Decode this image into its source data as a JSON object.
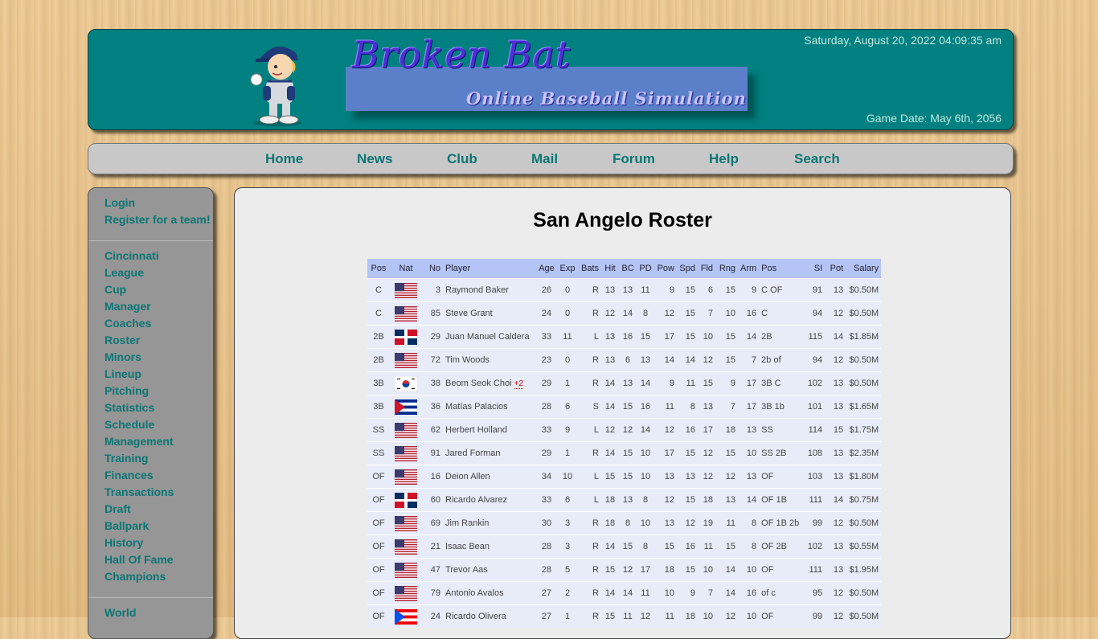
{
  "header": {
    "title": "Broken Bat",
    "subtitle": "Online Baseball Simulation",
    "datetime": "Saturday, August 20, 2022 04:09:35 am",
    "game_date": "Game Date: May 6th, 2056"
  },
  "nav": [
    "Home",
    "News",
    "Club",
    "Mail",
    "Forum",
    "Help",
    "Search"
  ],
  "sidebar": {
    "account": [
      "Login",
      "Register for a team!"
    ],
    "links": [
      "Cincinnati",
      "League",
      "Cup",
      "Manager",
      "Coaches",
      "Roster",
      "Minors",
      "Lineup",
      "Pitching",
      "Statistics",
      "Schedule",
      "Management",
      "Training",
      "Finances",
      "Transactions",
      "Draft",
      "Ballpark",
      "History",
      "Hall Of Fame",
      "Champions"
    ],
    "world": "World"
  },
  "main": {
    "title": "San Angelo Roster",
    "columns": [
      "Pos",
      "Nat",
      "No",
      "Player",
      "Age",
      "Exp",
      "Bats",
      "Hit",
      "BC",
      "PD",
      "Pow",
      "Spd",
      "Fld",
      "Rng",
      "Arm",
      "Pos",
      "SI",
      "Pot",
      "Salary"
    ],
    "players": [
      {
        "pos": "C",
        "nat": "us",
        "no": "3",
        "name": "Raymond Baker",
        "age": "26",
        "exp": "0",
        "bats": "R",
        "hit": "13",
        "bc": "13",
        "pd": "11",
        "pow": "9",
        "spd": "15",
        "fld": "6",
        "rng": "15",
        "arm": "9",
        "pos2": "C OF",
        "si": "91",
        "pot": "13",
        "salary": "$0.50M"
      },
      {
        "pos": "C",
        "nat": "us",
        "no": "85",
        "name": "Steve Grant",
        "age": "24",
        "exp": "0",
        "bats": "R",
        "hit": "12",
        "bc": "14",
        "pd": "8",
        "pow": "12",
        "spd": "15",
        "fld": "7",
        "rng": "10",
        "arm": "16",
        "pos2": "C",
        "si": "94",
        "pot": "12",
        "salary": "$0.50M"
      },
      {
        "pos": "2B",
        "nat": "do",
        "no": "29",
        "name": "Juan Manuel Caldera",
        "age": "33",
        "exp": "11",
        "bats": "L",
        "hit": "13",
        "bc": "16",
        "pd": "15",
        "pow": "17",
        "spd": "15",
        "fld": "10",
        "rng": "15",
        "arm": "14",
        "pos2": "2B",
        "si": "115",
        "pot": "14",
        "salary": "$1.85M"
      },
      {
        "pos": "2B",
        "nat": "us",
        "no": "72",
        "name": "Tim Woods",
        "age": "23",
        "exp": "0",
        "bats": "R",
        "hit": "13",
        "bc": "6",
        "pd": "13",
        "pow": "14",
        "spd": "14",
        "fld": "12",
        "rng": "15",
        "arm": "7",
        "pos2": "2b of",
        "si": "94",
        "pot": "12",
        "salary": "$0.50M"
      },
      {
        "pos": "3B",
        "nat": "kr",
        "no": "38",
        "name": "Beom Seok Choi",
        "extra": "+2",
        "age": "29",
        "exp": "1",
        "bats": "R",
        "hit": "14",
        "bc": "13",
        "pd": "14",
        "pow": "9",
        "spd": "11",
        "fld": "15",
        "rng": "9",
        "arm": "17",
        "pos2": "3B C",
        "si": "102",
        "pot": "13",
        "salary": "$0.50M"
      },
      {
        "pos": "3B",
        "nat": "cu",
        "no": "36",
        "name": "Matías Palacios",
        "age": "28",
        "exp": "6",
        "bats": "S",
        "hit": "14",
        "bc": "15",
        "pd": "16",
        "pow": "11",
        "spd": "8",
        "fld": "13",
        "rng": "7",
        "arm": "17",
        "pos2": "3B 1b",
        "si": "101",
        "pot": "13",
        "salary": "$1.65M"
      },
      {
        "pos": "SS",
        "nat": "us",
        "no": "62",
        "name": "Herbert Holland",
        "age": "33",
        "exp": "9",
        "bats": "L",
        "hit": "12",
        "bc": "12",
        "pd": "14",
        "pow": "12",
        "spd": "16",
        "fld": "17",
        "rng": "18",
        "arm": "13",
        "pos2": "SS",
        "si": "114",
        "pot": "15",
        "salary": "$1.75M"
      },
      {
        "pos": "SS",
        "nat": "us",
        "no": "91",
        "name": "Jared Forman",
        "age": "29",
        "exp": "1",
        "bats": "R",
        "hit": "14",
        "bc": "15",
        "pd": "10",
        "pow": "17",
        "spd": "15",
        "fld": "12",
        "rng": "15",
        "arm": "10",
        "pos2": "SS 2B",
        "si": "108",
        "pot": "13",
        "salary": "$2.35M"
      },
      {
        "pos": "OF",
        "nat": "us",
        "no": "16",
        "name": "Deion Allen",
        "age": "34",
        "exp": "10",
        "bats": "L",
        "hit": "15",
        "bc": "15",
        "pd": "10",
        "pow": "13",
        "spd": "13",
        "fld": "12",
        "rng": "12",
        "arm": "13",
        "pos2": "OF",
        "si": "103",
        "pot": "13",
        "salary": "$1.80M"
      },
      {
        "pos": "OF",
        "nat": "do",
        "no": "60",
        "name": "Ricardo Alvarez",
        "age": "33",
        "exp": "6",
        "bats": "L",
        "hit": "18",
        "bc": "13",
        "pd": "8",
        "pow": "12",
        "spd": "15",
        "fld": "18",
        "rng": "13",
        "arm": "14",
        "pos2": "OF 1B",
        "si": "111",
        "pot": "14",
        "salary": "$0.75M"
      },
      {
        "pos": "OF",
        "nat": "us",
        "no": "69",
        "name": "Jim Rankin",
        "age": "30",
        "exp": "3",
        "bats": "R",
        "hit": "18",
        "bc": "8",
        "pd": "10",
        "pow": "13",
        "spd": "12",
        "fld": "19",
        "rng": "11",
        "arm": "8",
        "pos2": "OF 1B 2b",
        "si": "99",
        "pot": "12",
        "salary": "$0.50M"
      },
      {
        "pos": "OF",
        "nat": "us",
        "no": "21",
        "name": "Isaac Bean",
        "age": "28",
        "exp": "3",
        "bats": "R",
        "hit": "14",
        "bc": "15",
        "pd": "8",
        "pow": "15",
        "spd": "16",
        "fld": "11",
        "rng": "15",
        "arm": "8",
        "pos2": "OF 2B",
        "si": "102",
        "pot": "13",
        "salary": "$0.55M"
      },
      {
        "pos": "OF",
        "nat": "us",
        "no": "47",
        "name": "Trevor Aas",
        "age": "28",
        "exp": "5",
        "bats": "R",
        "hit": "15",
        "bc": "12",
        "pd": "17",
        "pow": "18",
        "spd": "15",
        "fld": "10",
        "rng": "14",
        "arm": "10",
        "pos2": "OF",
        "si": "111",
        "pot": "13",
        "salary": "$1.95M"
      },
      {
        "pos": "OF",
        "nat": "us",
        "no": "79",
        "name": "Antonio Avalos",
        "age": "27",
        "exp": "2",
        "bats": "R",
        "hit": "14",
        "bc": "14",
        "pd": "11",
        "pow": "10",
        "spd": "9",
        "fld": "7",
        "rng": "14",
        "arm": "16",
        "pos2": "of c",
        "si": "95",
        "pot": "12",
        "salary": "$0.50M"
      },
      {
        "pos": "OF",
        "nat": "pr",
        "no": "24",
        "name": "Ricardo Olivera",
        "age": "27",
        "exp": "1",
        "bats": "R",
        "hit": "15",
        "bc": "11",
        "pd": "12",
        "pow": "11",
        "spd": "18",
        "fld": "10",
        "rng": "12",
        "arm": "10",
        "pos2": "OF",
        "si": "99",
        "pot": "12",
        "salary": "$0.50M"
      }
    ]
  }
}
